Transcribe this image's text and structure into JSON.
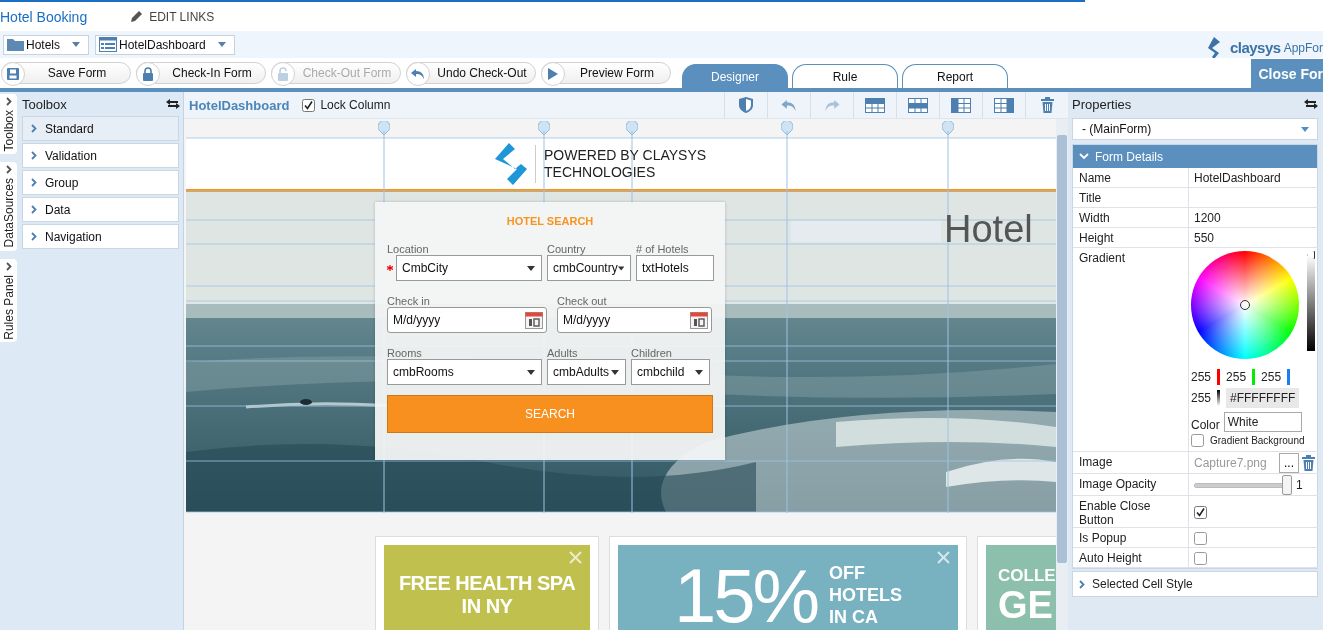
{
  "header": {
    "title": "Hotel Booking",
    "edit_links": "EDIT LINKS"
  },
  "selectors": [
    {
      "label": "Hotels",
      "kind": "folder"
    },
    {
      "label": "HotelDashboard",
      "kind": "form"
    }
  ],
  "brand": {
    "name": "claysys",
    "product": "AppFor"
  },
  "actions": [
    {
      "label": "Save Form",
      "kind": "save",
      "disabled": false
    },
    {
      "label": "Check-In Form",
      "kind": "lock",
      "disabled": false
    },
    {
      "label": "Check-Out Form",
      "kind": "unlock",
      "disabled": true
    },
    {
      "label": "Undo Check-Out",
      "kind": "undo",
      "disabled": false
    },
    {
      "label": "Preview Form",
      "kind": "play",
      "disabled": false
    }
  ],
  "tabs": [
    {
      "label": "Designer",
      "selected": true
    },
    {
      "label": "Rule",
      "selected": false
    },
    {
      "label": "Report",
      "selected": false
    }
  ],
  "close_button": "Close For",
  "side_tabs": [
    "Toolbox",
    "DataSources",
    "Rules Panel"
  ],
  "toolbox": {
    "title": "Toolbox",
    "items": [
      {
        "label": "Standard",
        "selected": true
      },
      {
        "label": "Validation",
        "selected": false
      },
      {
        "label": "Group",
        "selected": false
      },
      {
        "label": "Data",
        "selected": false
      },
      {
        "label": "Navigation",
        "selected": false
      }
    ]
  },
  "designer": {
    "form_name": "HotelDashboard",
    "lock_column": {
      "label": "Lock Column",
      "checked": true
    }
  },
  "form": {
    "tagline": "POWERED BY CLAYSYS TECHNOLOGIES",
    "hero_title": "Hotel",
    "search": {
      "title": "HOTEL SEARCH",
      "rows": [
        [
          {
            "label": "Location",
            "kind": "dropdown",
            "value": "CmbCity",
            "required": true
          },
          {
            "label": "Country",
            "kind": "dropdown",
            "value": "cmbCountry",
            "required": false
          },
          {
            "label": "# of Hotels",
            "kind": "text",
            "value": "txtHotels",
            "required": false
          }
        ],
        [
          {
            "label": "Check in",
            "kind": "date",
            "value": "M/d/yyyy",
            "required": false
          },
          {
            "label": "Check out",
            "kind": "date",
            "value": "M/d/yyyy",
            "required": false
          }
        ],
        [
          {
            "label": "Rooms",
            "kind": "dropdown",
            "value": "cmbRooms",
            "required": false
          },
          {
            "label": "Adults",
            "kind": "dropdown",
            "value": "cmbAdults",
            "required": false
          },
          {
            "label": "Children",
            "kind": "dropdown",
            "value": "cmbchild",
            "required": false
          }
        ]
      ],
      "button": "SEARCH"
    },
    "promos": [
      {
        "kind": "text",
        "color": "#c0c04e",
        "lines": [
          "FREE HEALTH SPA",
          "IN NY"
        ],
        "closable": true
      },
      {
        "kind": "percent",
        "color": "#78b1c0",
        "headline": "15%",
        "lines": [
          "OFF",
          "HOTELS",
          "IN CA"
        ],
        "closable": true
      },
      {
        "kind": "teaser",
        "color": "#8cc0ad",
        "lines": [
          "COLLE"
        ],
        "headline": "GE",
        "closable": false
      }
    ]
  },
  "properties": {
    "title": "Properties",
    "object": "- (MainForm)",
    "section": "Form Details",
    "rows": [
      {
        "name": "Name",
        "kind": "text",
        "value": "HotelDashboard"
      },
      {
        "name": "Title",
        "kind": "text"
      },
      {
        "name": "Width",
        "kind": "text",
        "value": "1200"
      },
      {
        "name": "Height",
        "kind": "text",
        "value": "550"
      },
      {
        "name": "Gradient",
        "kind": "color",
        "r": "255",
        "g": "255",
        "b": "255",
        "a": "255",
        "hex": "#FFFFFFFF",
        "level": 1,
        "color_label": "Color",
        "color_name": "White",
        "gradient_label": "Gradient Background",
        "gradient_checked": false
      },
      {
        "name": "Image",
        "kind": "file",
        "value": "Capture7.png",
        "browse": "..."
      },
      {
        "name": "Image Opacity",
        "kind": "slider",
        "level": 1,
        "reading": "1"
      },
      {
        "name": "Enable Close Button",
        "kind": "check",
        "checked": true
      },
      {
        "name": "Is Popup",
        "kind": "check",
        "checked": false
      },
      {
        "name": "Auto Height",
        "kind": "check",
        "checked": false
      }
    ],
    "footer_section": "Selected Cell Style"
  }
}
